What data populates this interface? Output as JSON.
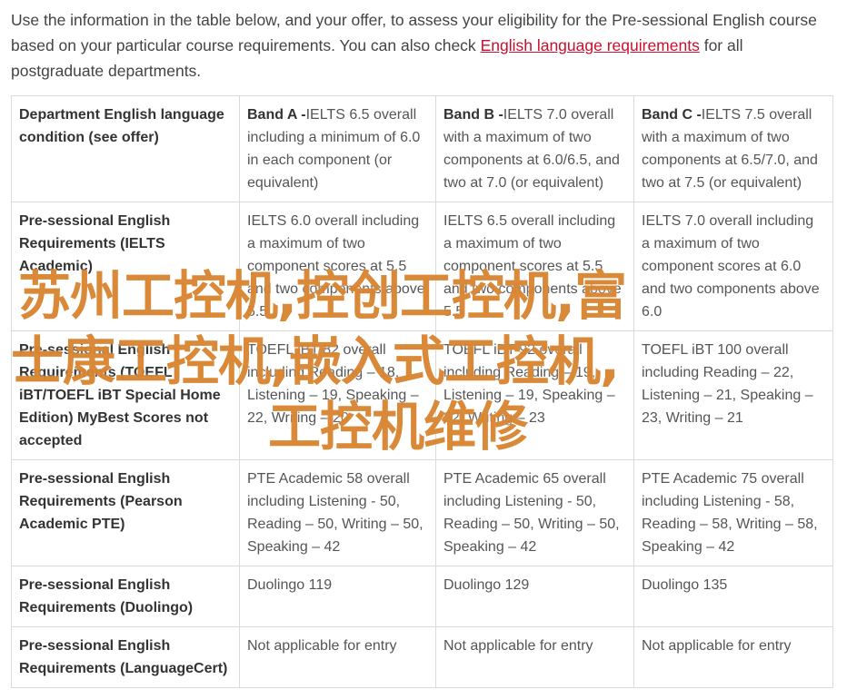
{
  "intro": {
    "text_before": "Use the information in the table below, and your offer, to assess your eligibility for the Pre-sessional English course based on your particular course requirements. You can also check ",
    "link_text": "English language requirements",
    "text_after": " for all postgraduate departments."
  },
  "table": {
    "rows": [
      {
        "label": "Department English language condition (see offer)",
        "cells": [
          {
            "band": "Band A -",
            "text": "IELTS 6.5 overall including a minimum of 6.0 in each component (or equivalent)"
          },
          {
            "band": "Band B -",
            "text": "IELTS 7.0 overall with a maximum of two components at 6.0/6.5, and two at 7.0 (or equivalent)"
          },
          {
            "band": "Band C -",
            "text": "IELTS 7.5 overall with a maximum of two components at 6.5/7.0, and two at 7.5 (or equivalent)"
          }
        ]
      },
      {
        "label": "Pre-sessional English Requirements (IELTS Academic)",
        "cells": [
          {
            "text": "IELTS 6.0 overall including a maximum of two component scores at 5.5 and two components above 5.5"
          },
          {
            "text": "IELTS 6.5 overall including a maximum of two component scores at 5.5 and two components above 5.5"
          },
          {
            "text": "IELTS 7.0 overall including a maximum of two component scores at 6.0 and two components above 6.0"
          }
        ]
      },
      {
        "label": "Pre-sessional English Requirements (TOEFL iBT/TOEFL iBT Special Home Edition) MyBest Scores not accepted",
        "cells": [
          {
            "text": "TOEFL iBT 82 overall including Reading – 18, Listening – 19, Speaking – 22, Writing – 20"
          },
          {
            "text": "TOEFL iBT 92 overall including Reading – 19, Listening – 19, Speaking – 22, Writing – 23"
          },
          {
            "text": "TOEFL iBT 100 overall including Reading – 22, Listening – 21, Speaking – 23, Writing – 21"
          }
        ]
      },
      {
        "label": "Pre-sessional English Requirements (Pearson Academic PTE)",
        "cells": [
          {
            "text": "PTE Academic 58 overall including Listening - 50, Reading – 50, Writing – 50, Speaking – 42"
          },
          {
            "text": "PTE Academic 65 overall including Listening - 50, Reading – 50, Writing – 50, Speaking – 42"
          },
          {
            "text": "PTE Academic 75 overall including Listening - 58, Reading – 58, Writing – 58, Speaking – 42"
          }
        ]
      },
      {
        "label": "Pre-sessional English Requirements (Duolingo)",
        "cells": [
          {
            "text": "Duolingo 119"
          },
          {
            "text": "Duolingo 129"
          },
          {
            "text": "Duolingo 135"
          }
        ]
      },
      {
        "label": "Pre-sessional English Requirements (LanguageCert)",
        "cells": [
          {
            "text": "Not applicable for entry"
          },
          {
            "text": "Not applicable for entry"
          },
          {
            "text": "Not applicable for entry"
          }
        ]
      }
    ]
  },
  "watermark": {
    "line1": "苏州工控机,控创工控机,富",
    "line2": "士康工控机,嵌入式工控机,",
    "line3": "工控机维修"
  },
  "colors": {
    "link": "#c8102e",
    "border": "#dadada",
    "watermark": "#d68028"
  }
}
